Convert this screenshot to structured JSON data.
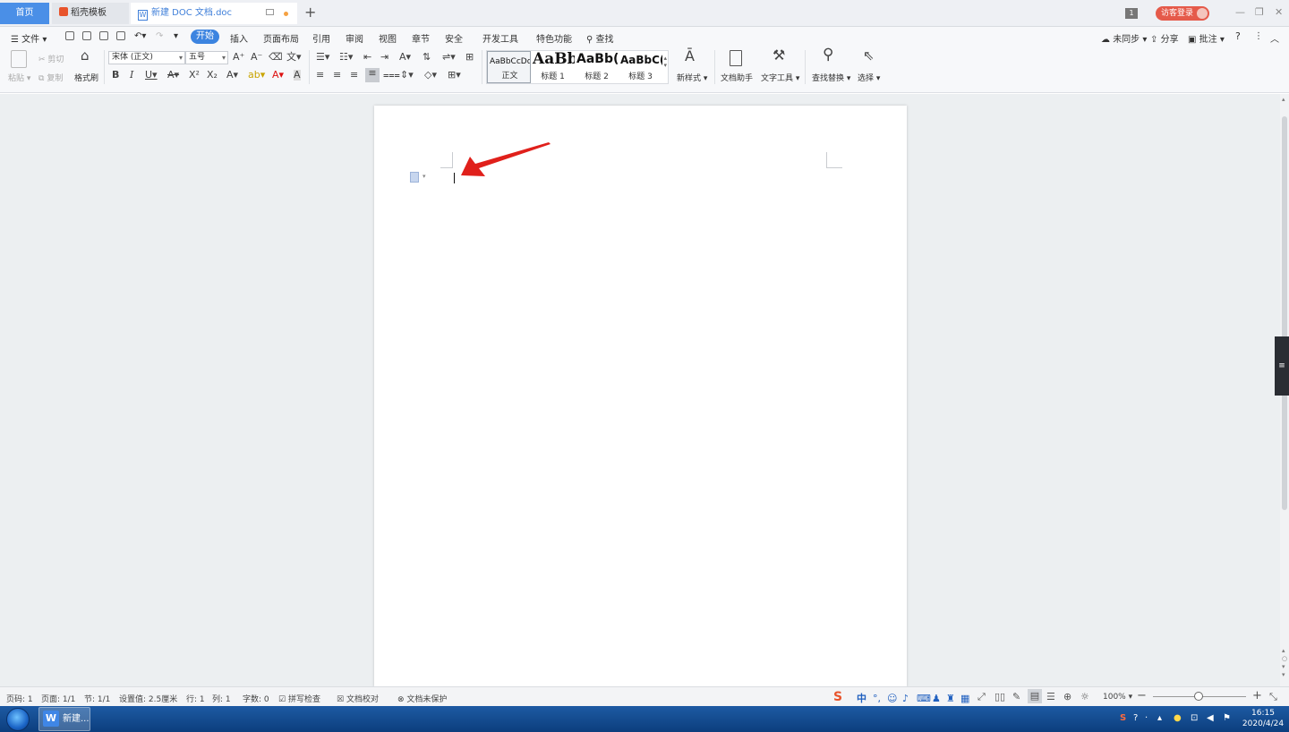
{
  "tabs": {
    "home": "首页",
    "template": "稻壳模板",
    "document": "新建 DOC 文档.doc",
    "new_tab": "+"
  },
  "topright": {
    "page_count": "1",
    "login": "访客登录"
  },
  "menu": {
    "file": "文件",
    "items": [
      "开始",
      "插入",
      "页面布局",
      "引用",
      "审阅",
      "视图",
      "章节",
      "安全",
      "开发工具",
      "特色功能"
    ],
    "search": "查找",
    "sync": "未同步",
    "share": "分享",
    "comment": "批注",
    "help": "?"
  },
  "ribbon": {
    "paste": "粘贴",
    "cut": "剪切",
    "copy": "复制",
    "format_painter": "格式刷",
    "font_name": "宋体 (正文)",
    "font_size": "五号",
    "styles": [
      {
        "preview": "AaBbCcDd",
        "label": "正文"
      },
      {
        "preview": "AaBb",
        "label": "标题 1"
      },
      {
        "preview": "AaBb(",
        "label": "标题 2"
      },
      {
        "preview": "AaBbC(",
        "label": "标题 3"
      }
    ],
    "new_style": "新样式",
    "doc_assistant": "文档助手",
    "text_tools": "文字工具",
    "find_replace": "查找替换",
    "select": "选择"
  },
  "status": {
    "page_no": "页码: 1",
    "pages": "页面: 1/1",
    "section": "节: 1/1",
    "setting": "设置值: 2.5厘米",
    "row": "行: 1",
    "col": "列: 1",
    "word_count": "字数: 0",
    "spell_check": "拼写检查",
    "proofread": "文档校对",
    "protect": "文档未保护",
    "ime_lang": "中",
    "zoom": "100%"
  },
  "taskbar": {
    "app_item": "新建...",
    "time": "16:15",
    "date": "2020/4/24"
  },
  "colors": {
    "accent": "#3c84e0",
    "arrow": "#e0201b",
    "login": "#e55a4a"
  }
}
